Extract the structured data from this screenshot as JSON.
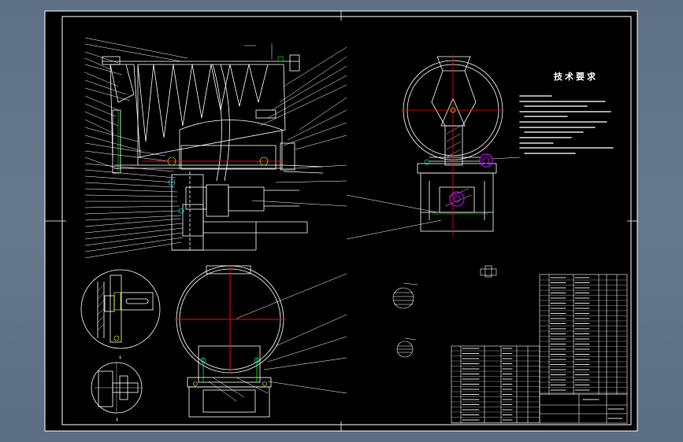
{
  "technical_requirements": {
    "title": "技术要求"
  },
  "colors": {
    "background": "#5e7186",
    "sheet": "#000000",
    "linework": "#ffffff",
    "centerline": "#ff0000",
    "hidden": "#00ff00",
    "purple": "#c000ff",
    "cyan": "#00ffff",
    "yellow": "#ffff00"
  }
}
